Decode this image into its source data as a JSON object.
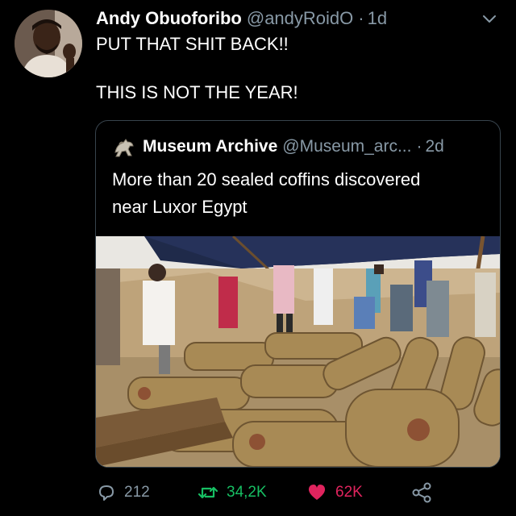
{
  "tweet": {
    "display_name": "Andy Obuoforibo",
    "handle": "@andyRoidO",
    "separator": "·",
    "time": "1d",
    "text_line1": "PUT THAT SHIT BACK!!",
    "text_line2": "THIS IS NOT THE YEAR!",
    "avatar_icon": "profile-photo",
    "menu_icon": "chevron-down-icon"
  },
  "quoted": {
    "display_name": "Museum Archive",
    "handle": "@Museum_arc...",
    "separator": "·",
    "time": "2d",
    "text_line1": "More than 20 sealed coffins discovered",
    "text_line2": "near Luxor Egypt",
    "avatar_icon": "horse-statue-icon",
    "photo": "excavation-site-coffins"
  },
  "actions": {
    "reply_count": "212",
    "retweet_count": "34,2K",
    "like_count": "62K",
    "reply_icon": "reply-icon",
    "retweet_icon": "retweet-icon",
    "like_icon": "heart-icon",
    "share_icon": "share-icon"
  },
  "colors": {
    "background": "#000000",
    "text": "#ffffff",
    "muted": "#8899a6",
    "border": "#38444d",
    "retweet": "#17bf63",
    "like": "#e0245e"
  }
}
